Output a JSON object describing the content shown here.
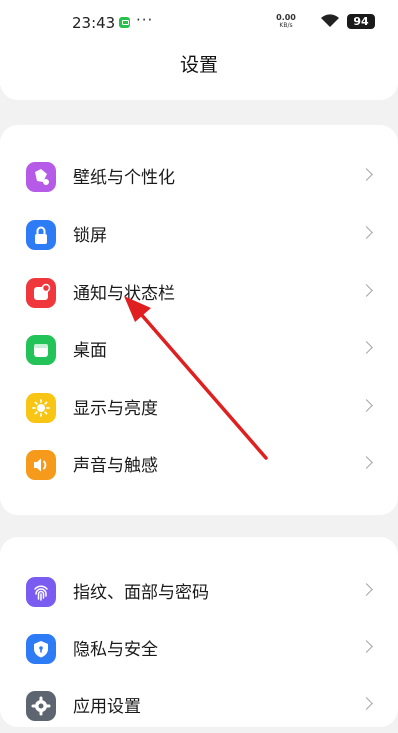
{
  "status_bar": {
    "time": "23:43",
    "more": "···",
    "net_speed_value": "0.00",
    "net_speed_unit": "KB/s",
    "battery": "94"
  },
  "header": {
    "title": "设置"
  },
  "groups": [
    {
      "items": [
        {
          "label": "壁纸与个性化",
          "icon": "palette-icon",
          "color": "#b65ae8"
        },
        {
          "label": "锁屏",
          "icon": "lock-icon",
          "color": "#2d7cf6"
        },
        {
          "label": "通知与状态栏",
          "icon": "notification-icon",
          "color": "#f0383c"
        },
        {
          "label": "桌面",
          "icon": "home-screen-icon",
          "color": "#23c35a"
        },
        {
          "label": "显示与亮度",
          "icon": "brightness-icon",
          "color": "#f9c514"
        },
        {
          "label": "声音与触感",
          "icon": "speaker-icon",
          "color": "#f59a1b"
        }
      ]
    },
    {
      "items": [
        {
          "label": "指纹、面部与密码",
          "icon": "fingerprint-icon",
          "color": "#7a5cf0"
        },
        {
          "label": "隐私与安全",
          "icon": "shield-icon",
          "color": "#2d7cf6"
        },
        {
          "label": "应用设置",
          "icon": "gear-icon",
          "color": "#5d6670"
        }
      ]
    }
  ],
  "annotation": {
    "icon": "red-pointer-arrow-icon",
    "color": "#e02020"
  }
}
